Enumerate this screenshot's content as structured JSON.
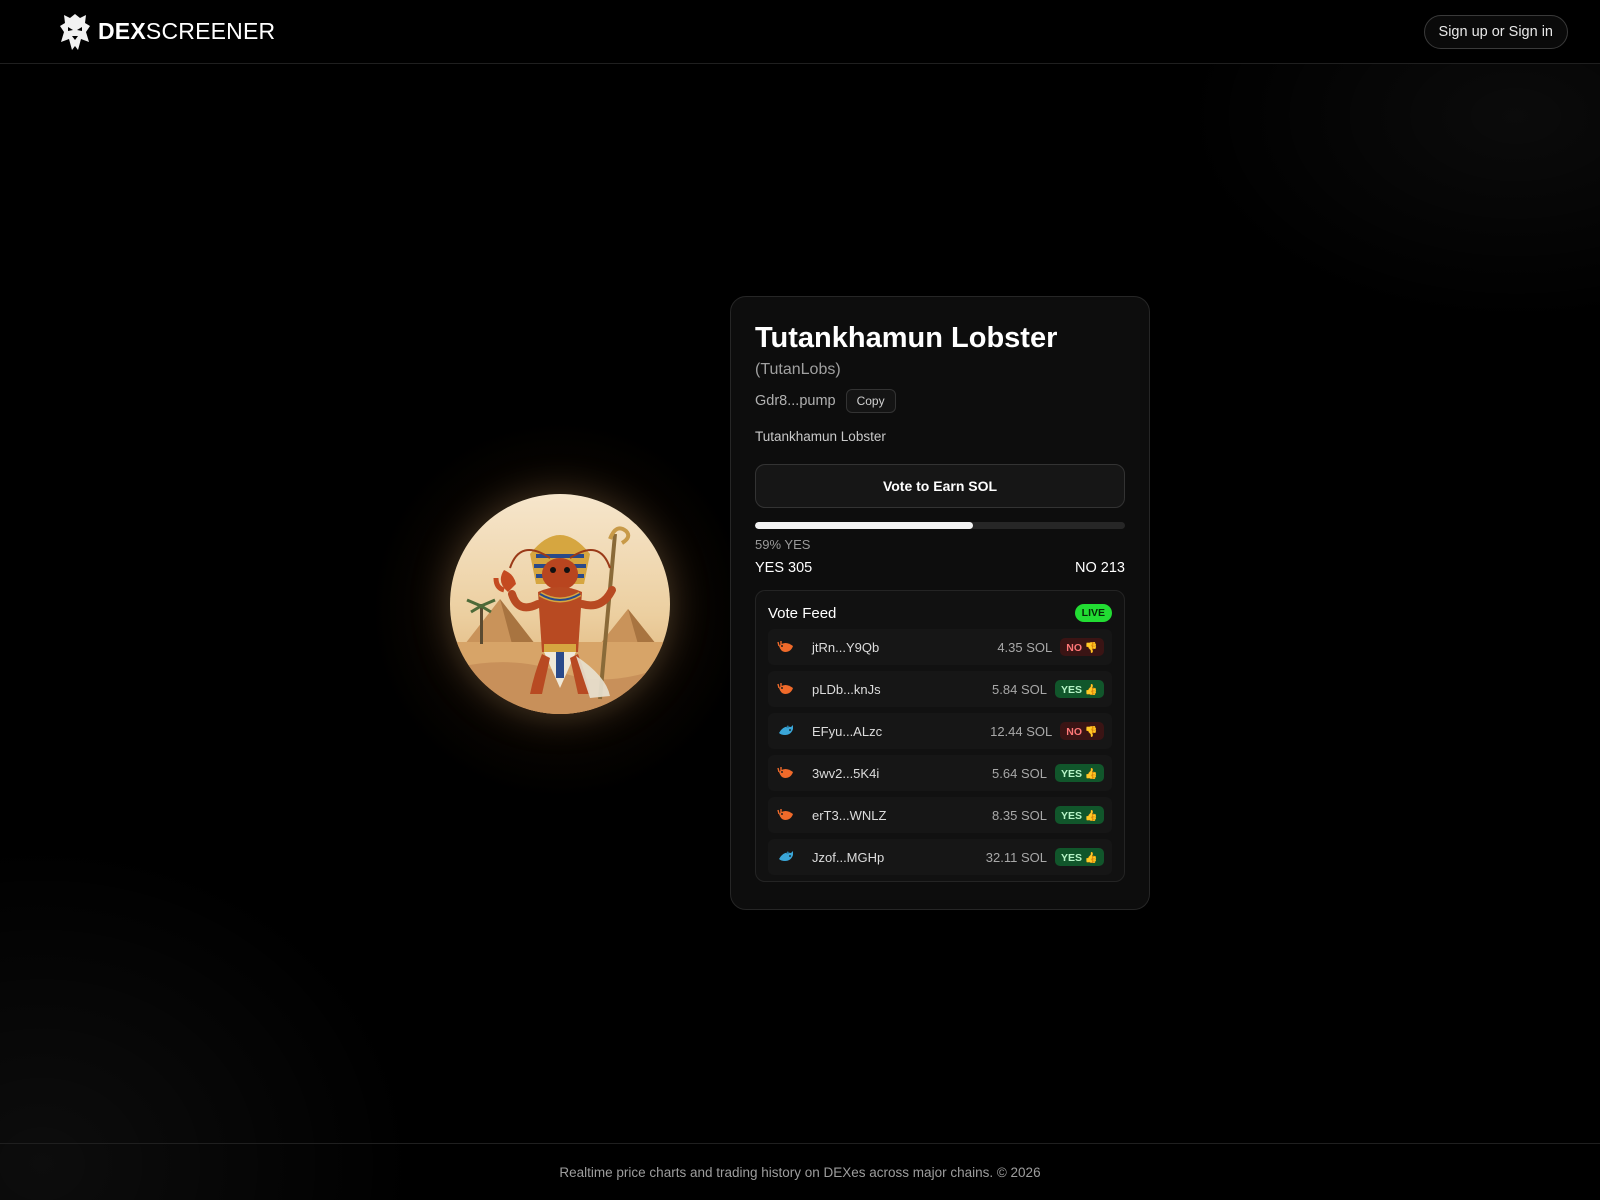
{
  "header": {
    "brand_bold": "DEX",
    "brand_light": "SCREENER",
    "signin_label": "Sign up or Sign in"
  },
  "token": {
    "name": "Tutankhamun Lobster",
    "symbol": "(TutanLobs)",
    "address_short": "Gdr8...pump",
    "copy_label": "Copy",
    "description": "Tutankhamun Lobster",
    "avatar_icon": "pharaoh-lobster-image"
  },
  "vote": {
    "button_label": "Vote to Earn SOL",
    "yes_fraction": 0.59,
    "pct_label": "59% YES",
    "yes_count_label": "YES 305",
    "no_count_label": "NO 213"
  },
  "feed": {
    "title": "Vote Feed",
    "live_label": "LIVE",
    "rows": [
      {
        "icon": "shrimp-icon",
        "wallet": "jtRn...Y9Qb",
        "amount": "4.35 SOL",
        "vote": "NO 👎",
        "kind": "no"
      },
      {
        "icon": "shrimp-icon",
        "wallet": "pLDb...knJs",
        "amount": "5.84 SOL",
        "vote": "YES 👍",
        "kind": "yes"
      },
      {
        "icon": "dolphin-icon",
        "wallet": "EFyu...ALzc",
        "amount": "12.44 SOL",
        "vote": "NO 👎",
        "kind": "no"
      },
      {
        "icon": "shrimp-icon",
        "wallet": "3wv2...5K4i",
        "amount": "5.64 SOL",
        "vote": "YES 👍",
        "kind": "yes"
      },
      {
        "icon": "shrimp-icon",
        "wallet": "erT3...WNLZ",
        "amount": "8.35 SOL",
        "vote": "YES 👍",
        "kind": "yes"
      },
      {
        "icon": "dolphin-icon",
        "wallet": "Jzof...MGHp",
        "amount": "32.11 SOL",
        "vote": "YES 👍",
        "kind": "yes"
      }
    ]
  },
  "colors": {
    "live": "#22dd33",
    "yes_badge_bg": "#11562b",
    "no_badge_bg": "#3a1414",
    "no_text": "#ff7777"
  },
  "footer": {
    "text": "Realtime price charts and trading history on DEXes across major chains. © 2026"
  }
}
